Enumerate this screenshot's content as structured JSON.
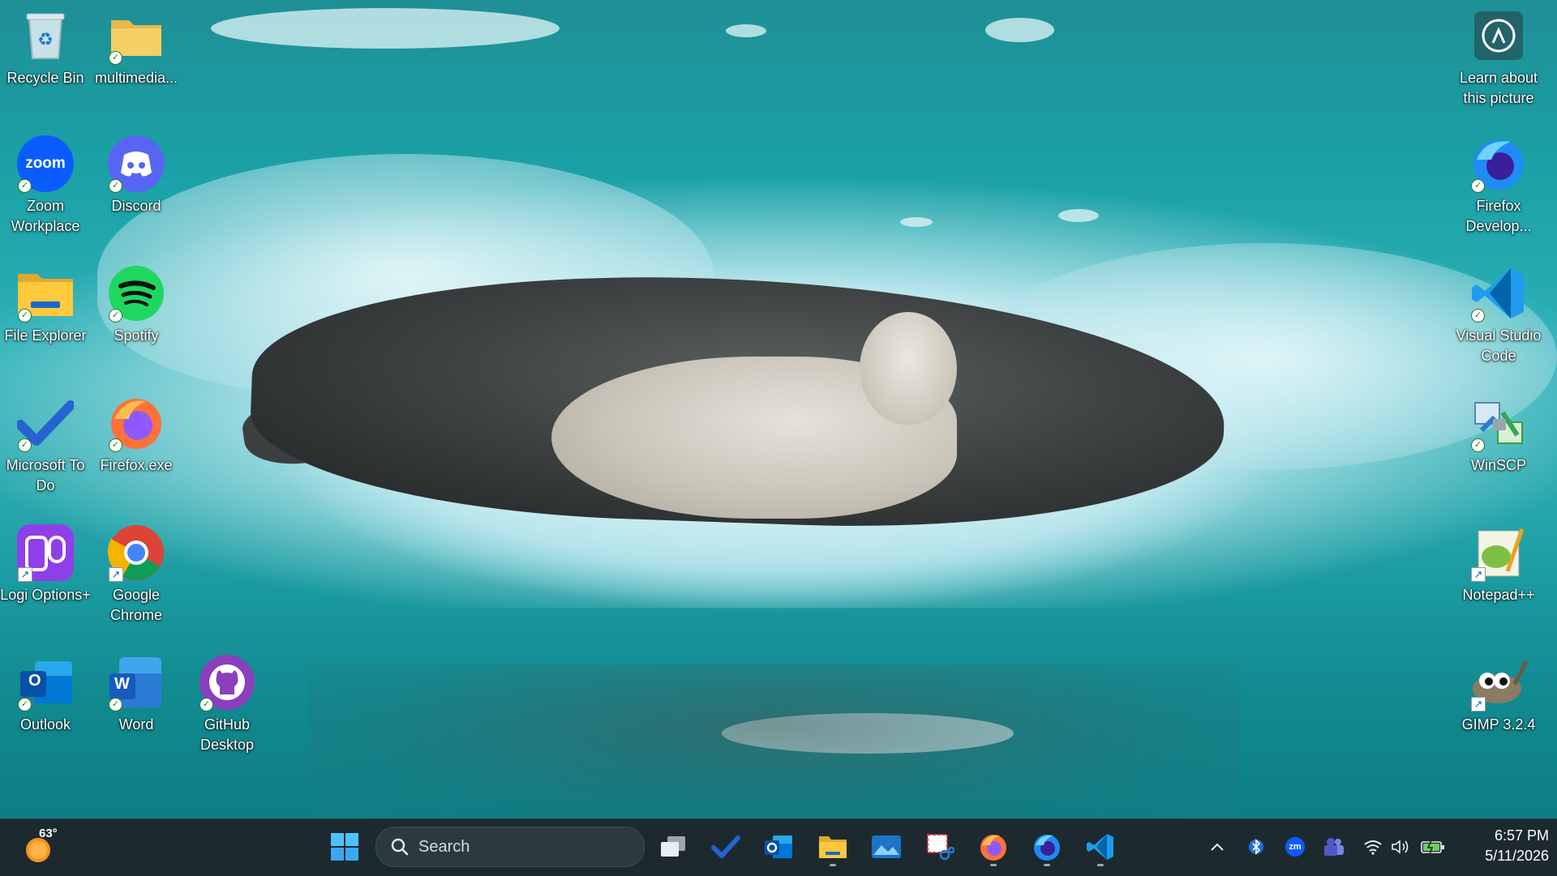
{
  "desktop": {
    "icons": [
      {
        "label": "Recycle Bin",
        "icon": "recycle-bin-icon"
      },
      {
        "label": "multimedia...",
        "icon": "folder-icon"
      },
      {
        "label": "Zoom Workplace",
        "icon": "zoom-icon",
        "glyph": "zoom"
      },
      {
        "label": "Discord",
        "icon": "discord-icon"
      },
      {
        "label": "File Explorer",
        "icon": "file-explorer-icon"
      },
      {
        "label": "Spotify",
        "icon": "spotify-icon"
      },
      {
        "label": "Microsoft To Do",
        "icon": "todo-icon"
      },
      {
        "label": "Firefox.exe",
        "icon": "firefox-icon"
      },
      {
        "label": "Logi Options+",
        "icon": "logi-options-icon"
      },
      {
        "label": "Google Chrome",
        "icon": "chrome-icon"
      },
      {
        "label": "Outlook",
        "icon": "outlook-icon",
        "glyph": "O"
      },
      {
        "label": "Word",
        "icon": "word-icon",
        "glyph": "W"
      },
      {
        "label": "GitHub Desktop",
        "icon": "github-desktop-icon"
      },
      {
        "label": "Learn about this picture",
        "icon": "learn-picture-icon"
      },
      {
        "label": "Firefox Develop...",
        "icon": "firefox-developer-icon"
      },
      {
        "label": "Visual Studio Code",
        "icon": "vscode-icon"
      },
      {
        "label": "WinSCP",
        "icon": "winscp-icon"
      },
      {
        "label": "Notepad++",
        "icon": "notepadpp-icon"
      },
      {
        "label": "GIMP 3.2.4",
        "icon": "gimp-icon"
      }
    ]
  },
  "taskbar": {
    "weather": {
      "temp": "63°",
      "icon": "weather-sun-icon"
    },
    "search_placeholder": "Search",
    "start_icon": "windows-start-icon",
    "pinned": [
      {
        "name": "task-view",
        "icon": "task-view-icon"
      },
      {
        "name": "todo",
        "icon": "todo-icon"
      },
      {
        "name": "outlook",
        "icon": "outlook-icon"
      },
      {
        "name": "file-explorer",
        "icon": "file-explorer-icon"
      },
      {
        "name": "photos",
        "icon": "photos-icon"
      },
      {
        "name": "snipping-tool",
        "icon": "snipping-tool-icon"
      },
      {
        "name": "firefox",
        "icon": "firefox-icon"
      },
      {
        "name": "firefox-developer",
        "icon": "firefox-developer-icon"
      },
      {
        "name": "vscode",
        "icon": "vscode-icon"
      }
    ],
    "tray": {
      "zoom_glyph": "zm",
      "icons": [
        "chevron-up-icon",
        "bluetooth-icon",
        "zoom-icon",
        "teams-icon",
        "wifi-icon",
        "volume-icon",
        "battery-icon"
      ]
    },
    "clock": {
      "time": "6:57 PM",
      "date": "5/11/2026"
    }
  },
  "colors": {
    "taskbar_bg": "#1c2a30",
    "water": "#1aa0a6",
    "accent_blue": "#0078d4"
  }
}
